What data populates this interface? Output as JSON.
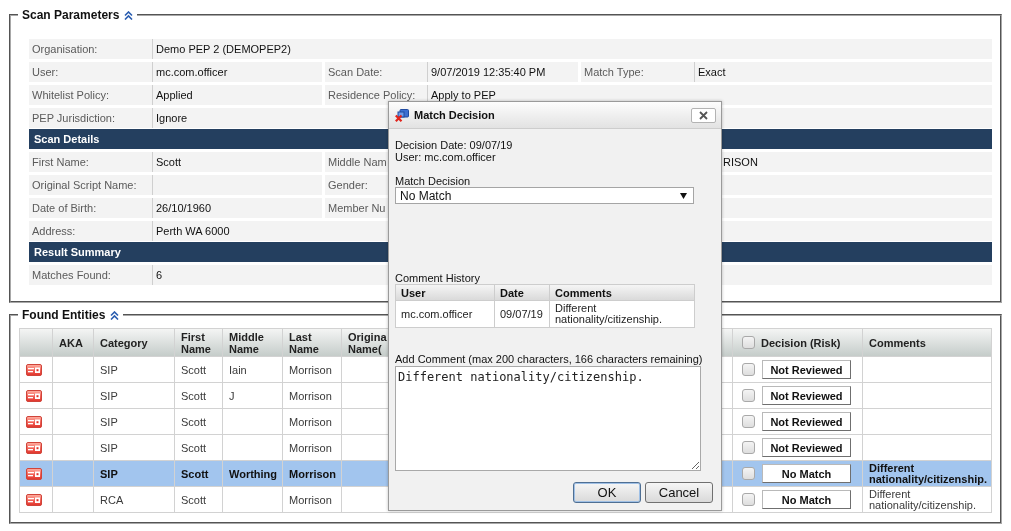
{
  "scan_parameters": {
    "title": "Scan Parameters",
    "rows": [
      {
        "kind": "fields",
        "fields": [
          {
            "label": "Organisation:",
            "value": "Demo PEP 2 (DEMOPEP2)"
          }
        ]
      },
      {
        "kind": "fields",
        "fields": [
          {
            "label": "User:",
            "value": "mc.com.officer"
          },
          {
            "label": "Scan Date:",
            "value": "9/07/2019 12:35:40 PM"
          },
          {
            "label": "Match Type:",
            "value": "Exact"
          }
        ]
      },
      {
        "kind": "fields",
        "fields": [
          {
            "label": "Whitelist Policy:",
            "value": "Applied"
          },
          {
            "label": "Residence Policy:",
            "value": "Apply to PEP"
          }
        ]
      },
      {
        "kind": "fields",
        "fields": [
          {
            "label": "PEP Jurisdiction:",
            "value": "Ignore"
          }
        ]
      },
      {
        "kind": "header",
        "title": "Scan Details"
      },
      {
        "kind": "fields",
        "fields": [
          {
            "label": "First Name:",
            "value": "Scott"
          },
          {
            "label": "Middle Nam"
          },
          {
            "value": "RISON"
          }
        ]
      },
      {
        "kind": "fields",
        "fields": [
          {
            "label": "Original Script Name:"
          },
          {
            "label": "Gender:"
          }
        ]
      },
      {
        "kind": "fields",
        "fields": [
          {
            "label": "Date of Birth:",
            "value": "26/10/1960"
          },
          {
            "label": "Member Nu"
          }
        ]
      },
      {
        "kind": "fields",
        "fields": [
          {
            "label": "Address:",
            "value": "Perth WA 6000"
          }
        ]
      },
      {
        "kind": "header",
        "title": "Result Summary"
      },
      {
        "kind": "fields",
        "fields": [
          {
            "label": "Matches Found:",
            "value": "6"
          }
        ]
      }
    ]
  },
  "found_entities": {
    "title": "Found Entities",
    "columns": [
      {
        "kind": "text",
        "label": "AKA"
      },
      {
        "kind": "text",
        "label": "Category"
      },
      {
        "kind": "text",
        "label": "First Name"
      },
      {
        "kind": "text",
        "label": "Middle Name"
      },
      {
        "kind": "text",
        "label": "Last Name"
      },
      {
        "kind": "text",
        "label": "Origina Name("
      },
      {
        "kind": "decision",
        "label": "Decision (Risk)",
        "checked": false
      },
      {
        "kind": "text",
        "label": "Comments"
      }
    ],
    "rows": [
      {
        "selected": false,
        "category": "SIP",
        "first_name": "Scott",
        "middle_name": "Iain",
        "last_name": "Morrison",
        "checked": false,
        "decision": "Not Reviewed"
      },
      {
        "selected": false,
        "category": "SIP",
        "first_name": "Scott",
        "middle_name": "J",
        "last_name": "Morrison",
        "checked": false,
        "decision": "Not Reviewed"
      },
      {
        "selected": false,
        "category": "SIP",
        "first_name": "Scott",
        "last_name": "Morrison",
        "checked": false,
        "decision": "Not Reviewed"
      },
      {
        "selected": false,
        "category": "SIP",
        "first_name": "Scott",
        "last_name": "Morrison",
        "checked": false,
        "decision": "Not Reviewed"
      },
      {
        "selected": true,
        "category": "SIP",
        "first_name": "Scott",
        "middle_name": "Worthing",
        "last_name": "Morrison",
        "checked": false,
        "decision": "No Match",
        "comments": "Different nationality/citizenship."
      },
      {
        "selected": false,
        "category": "RCA",
        "first_name": "Scott",
        "last_name": "Morrison",
        "checked": false,
        "decision": "No Match",
        "comments": "Different nationality/citizenship."
      }
    ]
  },
  "dialog": {
    "title": "Match Decision",
    "info_lines": [
      "Decision Date: 09/07/19",
      "User: mc.com.officer"
    ],
    "decision_label": "Match Decision",
    "decision_value": "No Match",
    "history_label": "Comment History",
    "history_columns": [
      "User",
      "Date",
      "Comments"
    ],
    "history_rows": [
      [
        "mc.com.officer",
        "09/07/19",
        "Different nationality/citizenship."
      ]
    ],
    "comment_label": "Add Comment (max 200 characters, 166 characters remaining)",
    "comment_value": "Different nationality/citizenship.",
    "buttons": [
      {
        "label": "OK",
        "default": true
      },
      {
        "label": "Cancel",
        "default": false
      }
    ]
  }
}
